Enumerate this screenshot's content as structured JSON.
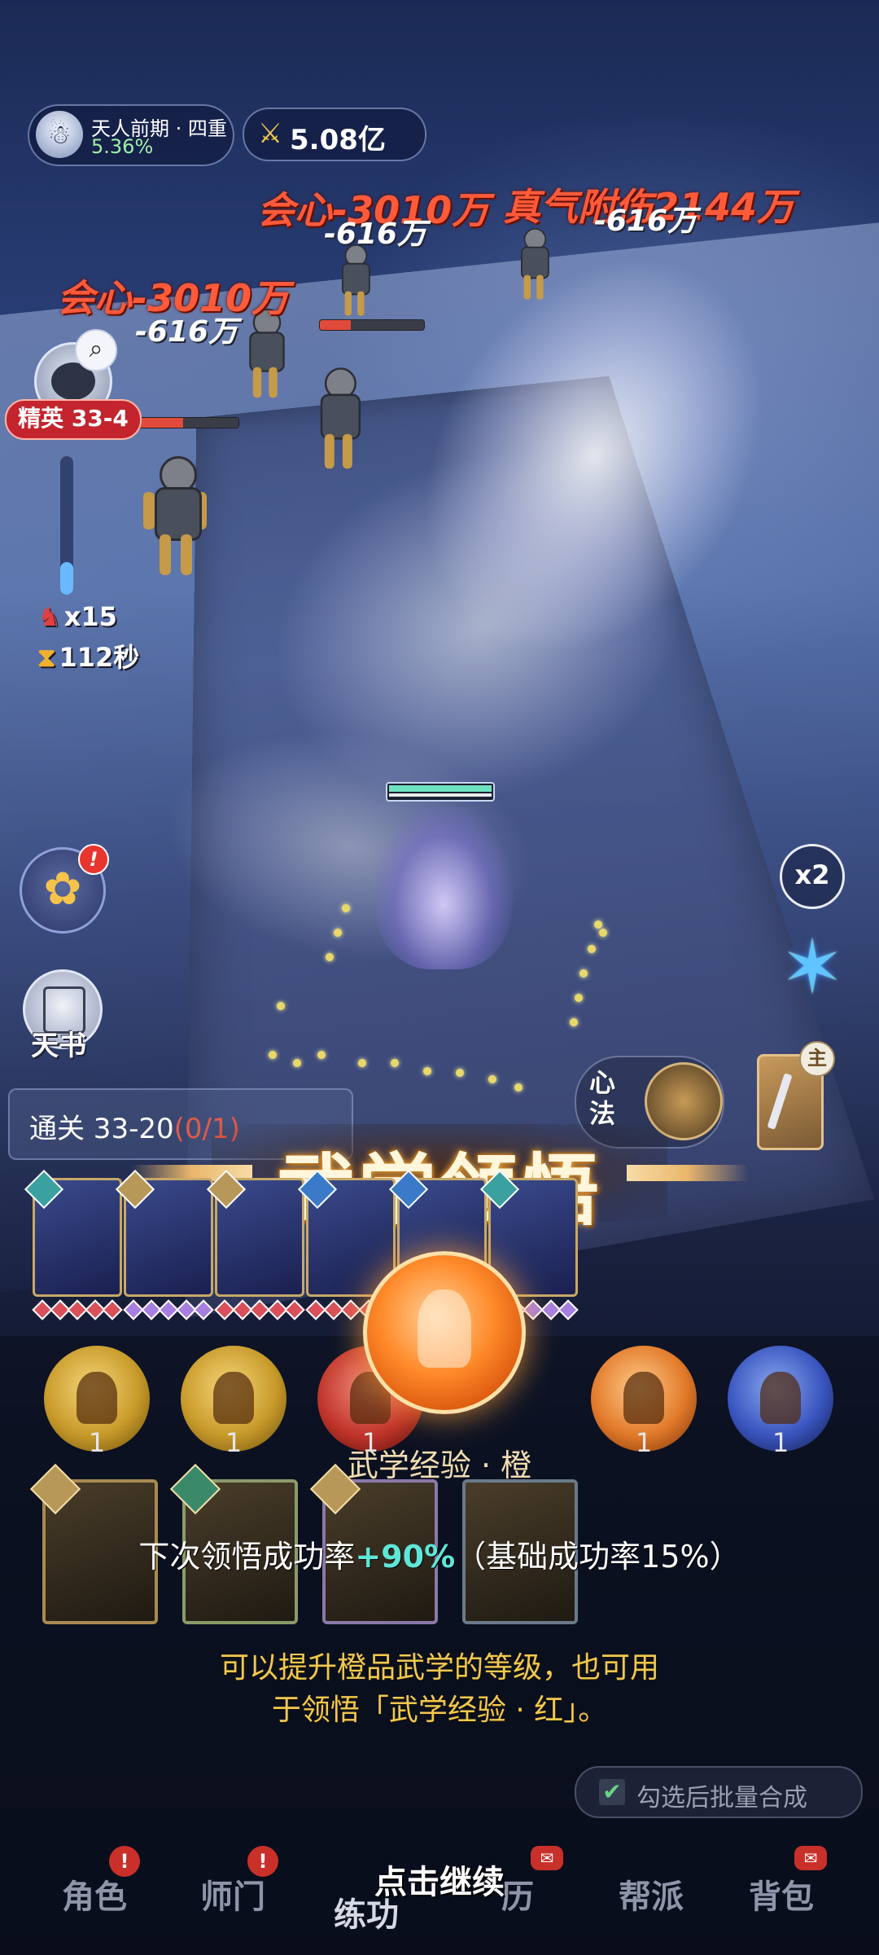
{
  "hud": {
    "realm_title": "天人前期 · 四重",
    "realm_percent": "5.36%",
    "power_value": "5.08亿"
  },
  "damage_numbers": [
    {
      "text": "会心-3010万",
      "kind": "crit"
    },
    {
      "text": "真气附伤2144万",
      "kind": "crit"
    },
    {
      "text": "-616万",
      "kind": "normal"
    },
    {
      "text": "-616万",
      "kind": "normal"
    },
    {
      "text": "会心-3010万",
      "kind": "crit"
    },
    {
      "text": "-616万",
      "kind": "normal"
    }
  ],
  "stage": {
    "tag": "精英 33-4",
    "kill_count": "x15",
    "time_left": "112秒",
    "clear_label": "通关 33-20",
    "clear_progress": "(0/1)"
  },
  "side_buttons": {
    "bag_badge": "!",
    "book_label": "天书",
    "speed_label": "x2",
    "xinfa_label": "心法",
    "weapon_tag": "主"
  },
  "banner": {
    "title": "武学领悟"
  },
  "skill_cards": [
    {
      "gem_color": "#d9505a",
      "badge": "#3aa0a0"
    },
    {
      "gem_color": "#a77fe0",
      "badge": "#b89858"
    },
    {
      "gem_color": "#d9505a",
      "badge": "#b89858"
    },
    {
      "gem_color": "#d9505a",
      "badge": "#3a7ac8"
    },
    {
      "gem_color": "#6ab0e8",
      "badge": "#3a7ac8"
    },
    {
      "gem_color": "#a77fe0",
      "badge": "#3aa0a0"
    }
  ],
  "exp_orbs": [
    {
      "count": "1",
      "color": "gold"
    },
    {
      "count": "1",
      "color": "gold"
    },
    {
      "count": "1",
      "color": "red"
    },
    {
      "count": "1",
      "color": "orange"
    },
    {
      "count": "1",
      "color": "blue"
    }
  ],
  "selected_item": {
    "name": "武学经验 · 橙",
    "rate_prefix": "下次领悟成功率",
    "rate_bonus": "+90%",
    "rate_base": "（基础成功率15%）",
    "desc_line1": "可以提升橙品武学的等级，也可用",
    "desc_line2": "于领悟「武学经验 · 红」。"
  },
  "batch_toggle": {
    "checked": true,
    "label": "勾选后批量合成"
  },
  "continue_prompt": "点击继续",
  "nav": [
    {
      "label": "角色",
      "badge": "!"
    },
    {
      "label": "师门",
      "badge": "!"
    },
    {
      "label": "练功",
      "badge": ""
    },
    {
      "label": "历",
      "badge": "✉"
    },
    {
      "label": "帮派",
      "badge": ""
    },
    {
      "label": "背包",
      "badge": "✉"
    }
  ],
  "colors": {
    "crit": "#ff5a3a",
    "stage_tag": "#c3242e",
    "bonus": "#5fe6d8",
    "desc": "#f2c84f"
  }
}
